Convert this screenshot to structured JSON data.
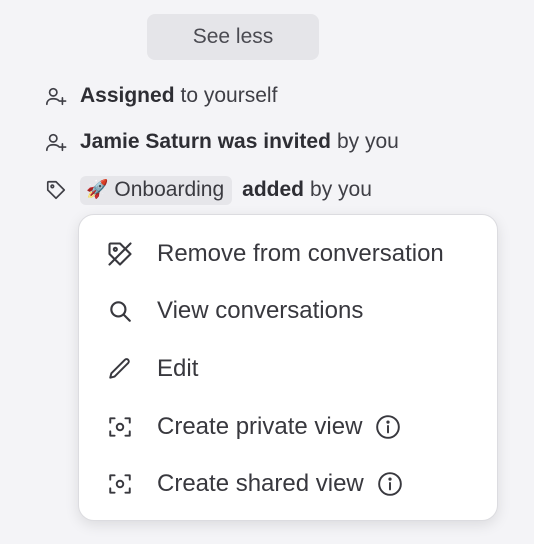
{
  "see_less": {
    "label": "See less"
  },
  "events": [
    {
      "bold": "Assigned",
      "rest": "to yourself",
      "icon": "user-plus-icon"
    },
    {
      "bold": "Jamie Saturn was invited",
      "rest": "by you",
      "icon": "user-plus-icon"
    },
    {
      "tag_emoji": "🚀",
      "tag_label": "Onboarding",
      "bold": "added",
      "rest": "by you",
      "icon": "tag-icon"
    }
  ],
  "menu": {
    "items": [
      {
        "label": "Remove from conversation",
        "icon": "tag-remove-icon"
      },
      {
        "label": "View conversations",
        "icon": "search-icon"
      },
      {
        "label": "Edit",
        "icon": "pencil-icon"
      },
      {
        "label": "Create private view",
        "icon": "view-icon",
        "info": true
      },
      {
        "label": "Create shared view",
        "icon": "view-icon",
        "info": true
      }
    ]
  }
}
